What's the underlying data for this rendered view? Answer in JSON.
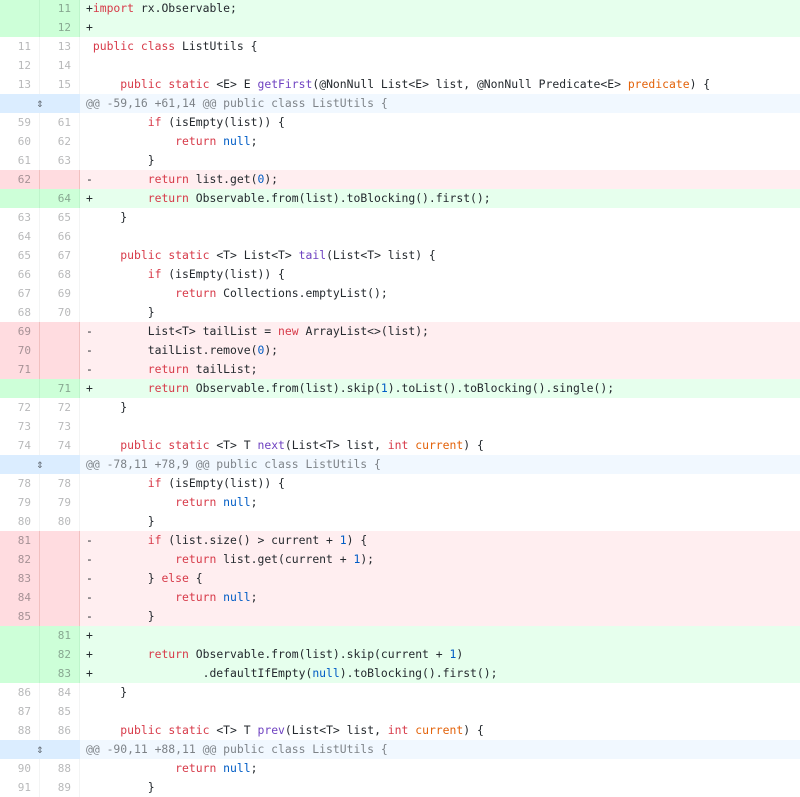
{
  "expand_icon": "unfold-icon",
  "colors": {
    "added_bg": "#e6ffed",
    "added_num_bg": "#cdffd8",
    "deleted_bg": "#ffeef0",
    "deleted_num_bg": "#ffdce0",
    "hunk_bg": "#f1f8ff",
    "keyword": "#d73a49",
    "type": "#6f42c1",
    "number": "#005cc5",
    "param": "#e36209"
  },
  "rows": [
    {
      "type": "add",
      "old": "",
      "new": "11",
      "code": "+import rx.Observable;"
    },
    {
      "type": "add",
      "old": "",
      "new": "12",
      "code": "+"
    },
    {
      "type": "ctx",
      "old": "11",
      "new": "13",
      "code": " public class ListUtils {"
    },
    {
      "type": "ctx",
      "old": "12",
      "new": "14",
      "code": " "
    },
    {
      "type": "ctx",
      "old": "13",
      "new": "15",
      "code": "     public static <E> E getFirst(@NonNull List<E> list, @NonNull Predicate<E> predicate) {"
    },
    {
      "type": "hunk",
      "old": "",
      "new": "",
      "code": "@@ -59,16 +61,14 @@ public class ListUtils {"
    },
    {
      "type": "ctx",
      "old": "59",
      "new": "61",
      "code": "         if (isEmpty(list)) {"
    },
    {
      "type": "ctx",
      "old": "60",
      "new": "62",
      "code": "             return null;"
    },
    {
      "type": "ctx",
      "old": "61",
      "new": "63",
      "code": "         }"
    },
    {
      "type": "del",
      "old": "62",
      "new": "",
      "code": "-        return list.get(0);"
    },
    {
      "type": "add",
      "old": "",
      "new": "64",
      "code": "+        return Observable.from(list).toBlocking().first();"
    },
    {
      "type": "ctx",
      "old": "63",
      "new": "65",
      "code": "     }"
    },
    {
      "type": "ctx",
      "old": "64",
      "new": "66",
      "code": " "
    },
    {
      "type": "ctx",
      "old": "65",
      "new": "67",
      "code": "     public static <T> List<T> tail(List<T> list) {"
    },
    {
      "type": "ctx",
      "old": "66",
      "new": "68",
      "code": "         if (isEmpty(list)) {"
    },
    {
      "type": "ctx",
      "old": "67",
      "new": "69",
      "code": "             return Collections.emptyList();"
    },
    {
      "type": "ctx",
      "old": "68",
      "new": "70",
      "code": "         }"
    },
    {
      "type": "del",
      "old": "69",
      "new": "",
      "code": "-        List<T> tailList = new ArrayList<>(list);"
    },
    {
      "type": "del",
      "old": "70",
      "new": "",
      "code": "-        tailList.remove(0);"
    },
    {
      "type": "del",
      "old": "71",
      "new": "",
      "code": "-        return tailList;"
    },
    {
      "type": "add",
      "old": "",
      "new": "71",
      "code": "+        return Observable.from(list).skip(1).toList().toBlocking().single();"
    },
    {
      "type": "ctx",
      "old": "72",
      "new": "72",
      "code": "     }"
    },
    {
      "type": "ctx",
      "old": "73",
      "new": "73",
      "code": " "
    },
    {
      "type": "ctx",
      "old": "74",
      "new": "74",
      "code": "     public static <T> T next(List<T> list, int current) {"
    },
    {
      "type": "hunk",
      "old": "",
      "new": "",
      "code": "@@ -78,11 +78,9 @@ public class ListUtils {"
    },
    {
      "type": "ctx",
      "old": "78",
      "new": "78",
      "code": "         if (isEmpty(list)) {"
    },
    {
      "type": "ctx",
      "old": "79",
      "new": "79",
      "code": "             return null;"
    },
    {
      "type": "ctx",
      "old": "80",
      "new": "80",
      "code": "         }"
    },
    {
      "type": "del",
      "old": "81",
      "new": "",
      "code": "-        if (list.size() > current + 1) {"
    },
    {
      "type": "del",
      "old": "82",
      "new": "",
      "code": "-            return list.get(current + 1);"
    },
    {
      "type": "del",
      "old": "83",
      "new": "",
      "code": "-        } else {"
    },
    {
      "type": "del",
      "old": "84",
      "new": "",
      "code": "-            return null;"
    },
    {
      "type": "del",
      "old": "85",
      "new": "",
      "code": "-        }"
    },
    {
      "type": "add",
      "old": "",
      "new": "81",
      "code": "+"
    },
    {
      "type": "add",
      "old": "",
      "new": "82",
      "code": "+        return Observable.from(list).skip(current + 1)"
    },
    {
      "type": "add",
      "old": "",
      "new": "83",
      "code": "+                .defaultIfEmpty(null).toBlocking().first();"
    },
    {
      "type": "ctx",
      "old": "86",
      "new": "84",
      "code": "     }"
    },
    {
      "type": "ctx",
      "old": "87",
      "new": "85",
      "code": " "
    },
    {
      "type": "ctx",
      "old": "88",
      "new": "86",
      "code": "     public static <T> T prev(List<T> list, int current) {"
    },
    {
      "type": "hunk",
      "old": "",
      "new": "",
      "code": "@@ -90,11 +88,11 @@ public class ListUtils {"
    },
    {
      "type": "ctx",
      "old": "90",
      "new": "88",
      "code": "             return null;"
    },
    {
      "type": "ctx",
      "old": "91",
      "new": "89",
      "code": "         }"
    }
  ]
}
